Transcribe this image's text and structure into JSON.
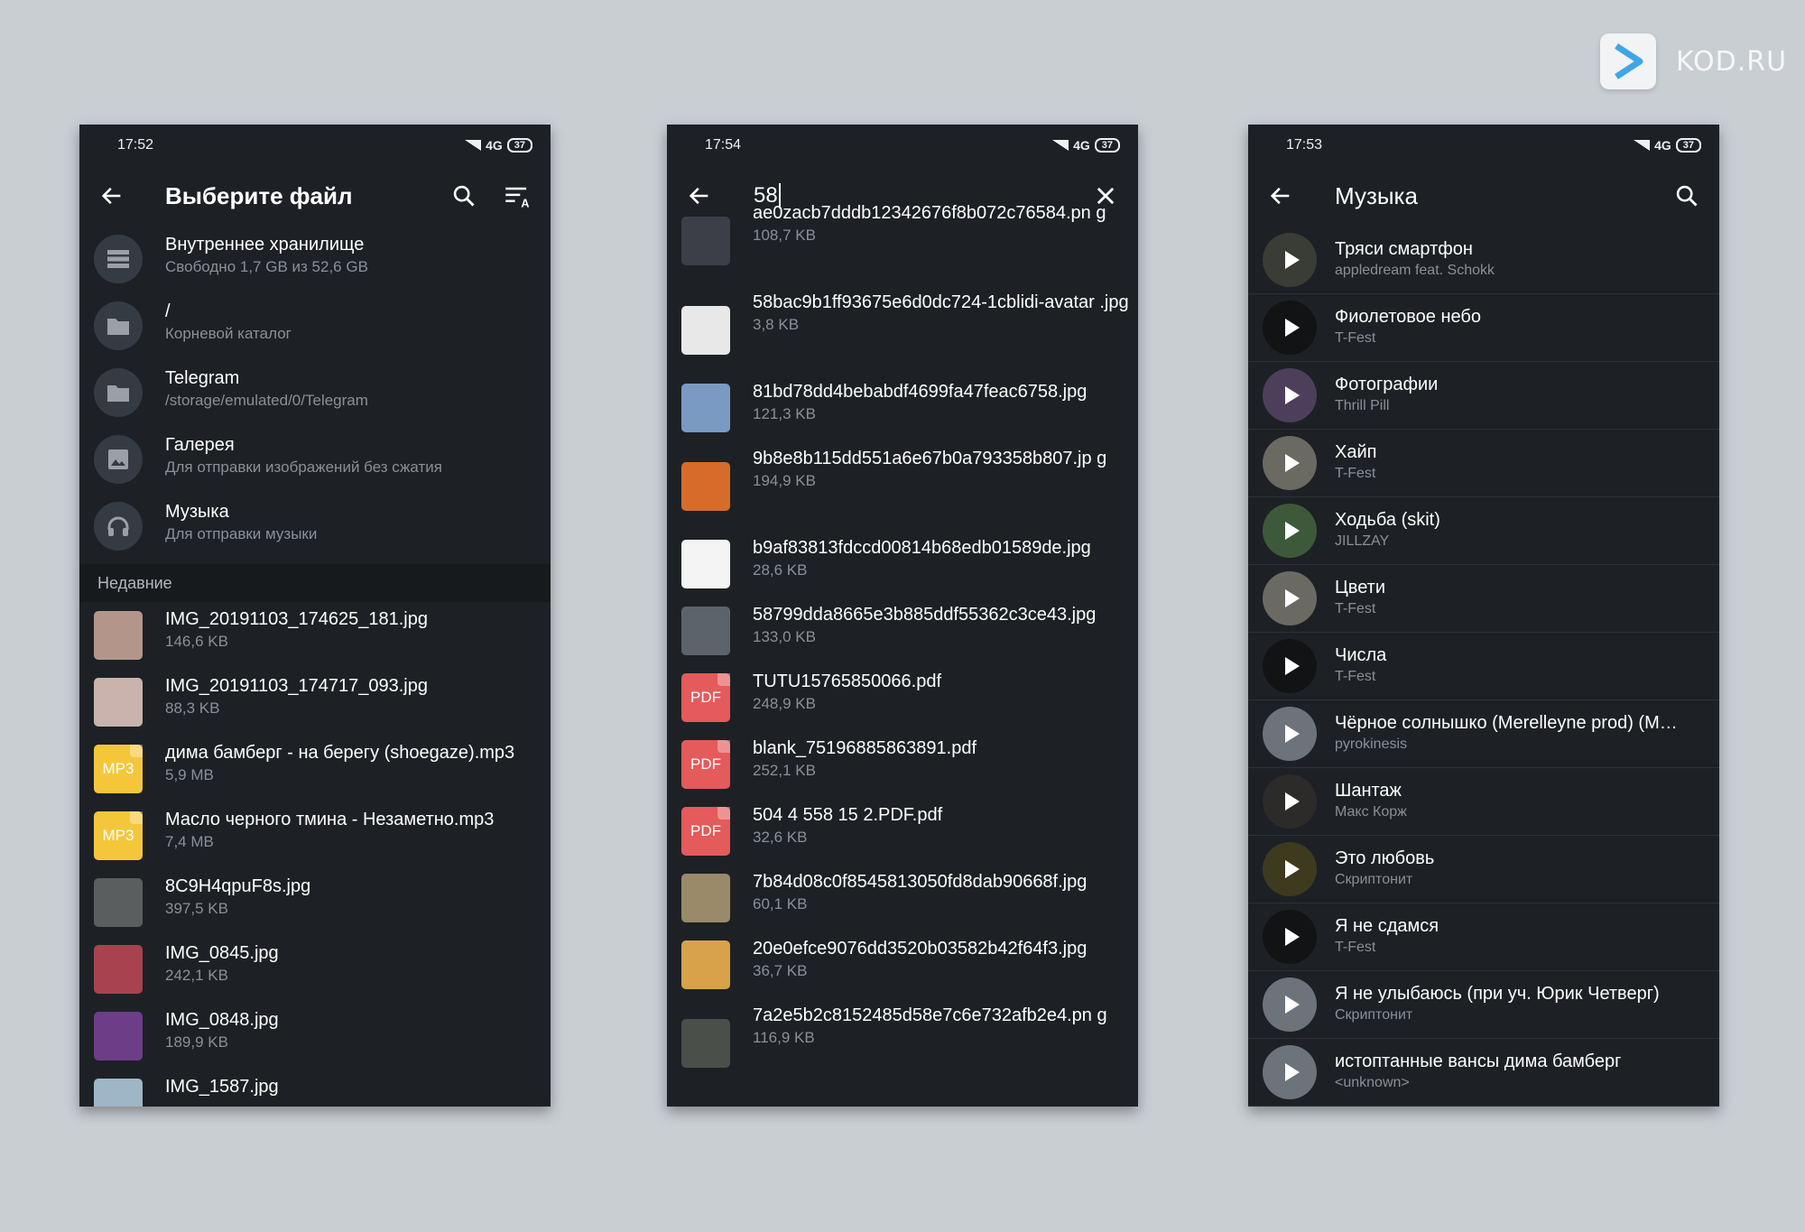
{
  "brand": {
    "name": "KOD.RU",
    "accent": "#3fa6e4"
  },
  "colors": {
    "bg": "#c9ced3",
    "phone_bg": "#1d2125",
    "mp3": "#f4c73b",
    "pdf": "#e55a5a"
  },
  "screens": [
    {
      "status": {
        "time": "17:52",
        "network": "4G",
        "battery": "37"
      },
      "title": "Выберите файл",
      "items": [
        {
          "name": "Внутреннее хранилище",
          "sub": "Свободно 1,7 GB из 52,6 GB",
          "icon": "storage-icon"
        },
        {
          "name": "/",
          "sub": "Корневой каталог",
          "icon": "folder-icon"
        },
        {
          "name": "Telegram",
          "sub": "/storage/emulated/0/Telegram",
          "icon": "folder-icon"
        },
        {
          "name": "Галерея",
          "sub": "Для отправки изображений без сжатия",
          "icon": "image-icon"
        },
        {
          "name": "Музыка",
          "sub": "Для отправки музыки",
          "icon": "headphones-icon"
        }
      ],
      "section": "Недавние",
      "recent": [
        {
          "name": "IMG_20191103_174625_181.jpg",
          "size": "146,6 KB",
          "kind": "thumb",
          "color": "#b4958a"
        },
        {
          "name": "IMG_20191103_174717_093.jpg",
          "size": "88,3 KB",
          "kind": "thumb",
          "color": "#c9b3ac"
        },
        {
          "name": "дима бамберг - на берегу (shoegaze).mp3",
          "size": "5,9 MB",
          "kind": "ext",
          "ext": "MP3"
        },
        {
          "name": "Масло черного тмина - Незаметно.mp3",
          "size": "7,4 MB",
          "kind": "ext",
          "ext": "MP3"
        },
        {
          "name": "8C9H4qpuF8s.jpg",
          "size": "397,5 KB",
          "kind": "thumb",
          "color": "#5b5e5f"
        },
        {
          "name": "IMG_0845.jpg",
          "size": "242,1 KB",
          "kind": "thumb",
          "color": "#a8424f"
        },
        {
          "name": "IMG_0848.jpg",
          "size": "189,9 KB",
          "kind": "thumb",
          "color": "#6e3d88"
        },
        {
          "name": "IMG_1587.jpg",
          "size": "",
          "kind": "thumb",
          "color": "#9fb6c6"
        }
      ]
    },
    {
      "status": {
        "time": "17:54",
        "network": "4G",
        "battery": "37"
      },
      "query": "58",
      "results": [
        {
          "name": "ae0zacb7dddb12342676f8b072c76584.pn g",
          "size": "108,7 KB",
          "kind": "thumb",
          "color": "#3c3f48"
        },
        {
          "name": "58bac9b1ff93675e6d0dc724-1cblidi-avatar .jpg",
          "size": "3,8 KB",
          "kind": "thumb",
          "color": "#e8e8e8"
        },
        {
          "name": "81bd78dd4bebabdf4699fa47feac6758.jpg",
          "size": "121,3 KB",
          "kind": "thumb",
          "color": "#7a9ac4"
        },
        {
          "name": "9b8e8b115dd551a6e67b0a793358b807.jp g",
          "size": "194,9 KB",
          "kind": "thumb",
          "color": "#d76c2a"
        },
        {
          "name": "b9af83813fdccd00814b68edb01589de.jpg",
          "size": "28,6 KB",
          "kind": "thumb",
          "color": "#f4f4f4"
        },
        {
          "name": "58799dda8665e3b885ddf55362c3ce43.jpg",
          "size": "133,0 KB",
          "kind": "thumb",
          "color": "#5d636a"
        },
        {
          "name": "TUTU15765850066.pdf",
          "size": "248,9 KB",
          "kind": "ext",
          "ext": "PDF"
        },
        {
          "name": "blank_75196885863891.pdf",
          "size": "252,1 KB",
          "kind": "ext",
          "ext": "PDF"
        },
        {
          "name": "504 4 558 15 2.PDF.pdf",
          "size": "32,6 KB",
          "kind": "ext",
          "ext": "PDF"
        },
        {
          "name": "7b84d08c0f8545813050fd8dab90668f.jpg",
          "size": "60,1 KB",
          "kind": "thumb",
          "color": "#9a8a6a"
        },
        {
          "name": "20e0efce9076dd3520b03582b42f64f3.jpg",
          "size": "36,7 KB",
          "kind": "thumb",
          "color": "#d8a24a"
        },
        {
          "name": "7a2e5b2c8152485d58e7c6e732afb2e4.pn g",
          "size": "116,9 KB",
          "kind": "thumb",
          "color": "#4a4f4a"
        }
      ]
    },
    {
      "status": {
        "time": "17:53",
        "network": "4G",
        "battery": "37"
      },
      "title": "Музыка",
      "tracks": [
        {
          "title": "Тряси смартфон",
          "artist": "appledream feat. Schokk",
          "color": "#3a3d36"
        },
        {
          "title": "Фиолетовое небо",
          "artist": "T-Fest",
          "color": "#121315"
        },
        {
          "title": "Фотографии",
          "artist": "Thrill Pill",
          "color": "#4d3f5c"
        },
        {
          "title": "Хайп",
          "artist": "T-Fest",
          "color": "#6b6a62"
        },
        {
          "title": "Ходьба (skit)",
          "artist": "JILLZAY",
          "color": "#3c5a3a"
        },
        {
          "title": "Цвети",
          "artist": "T-Fest",
          "color": "#6b6a62"
        },
        {
          "title": "Числа",
          "artist": "T-Fest",
          "color": "#121315"
        },
        {
          "title": "Чёрное солнышко (Merelleyne prod) (M…",
          "artist": "pyrokinesis",
          "color": "#6c737b"
        },
        {
          "title": "Шантаж",
          "artist": "Макс Корж",
          "color": "#2c2b2a"
        },
        {
          "title": "Это любовь",
          "artist": "Скриптонит",
          "color": "#3d3a1e"
        },
        {
          "title": "Я не сдамся",
          "artist": "T-Fest",
          "color": "#121315"
        },
        {
          "title": "Я не улыбаюсь (при уч. Юрик Четверг)",
          "artist": "Скриптонит",
          "color": "#6c737b"
        },
        {
          "title": "истоптанные вансы  дима бамберг",
          "artist": "<unknown>",
          "color": "#6c737b"
        }
      ]
    }
  ]
}
